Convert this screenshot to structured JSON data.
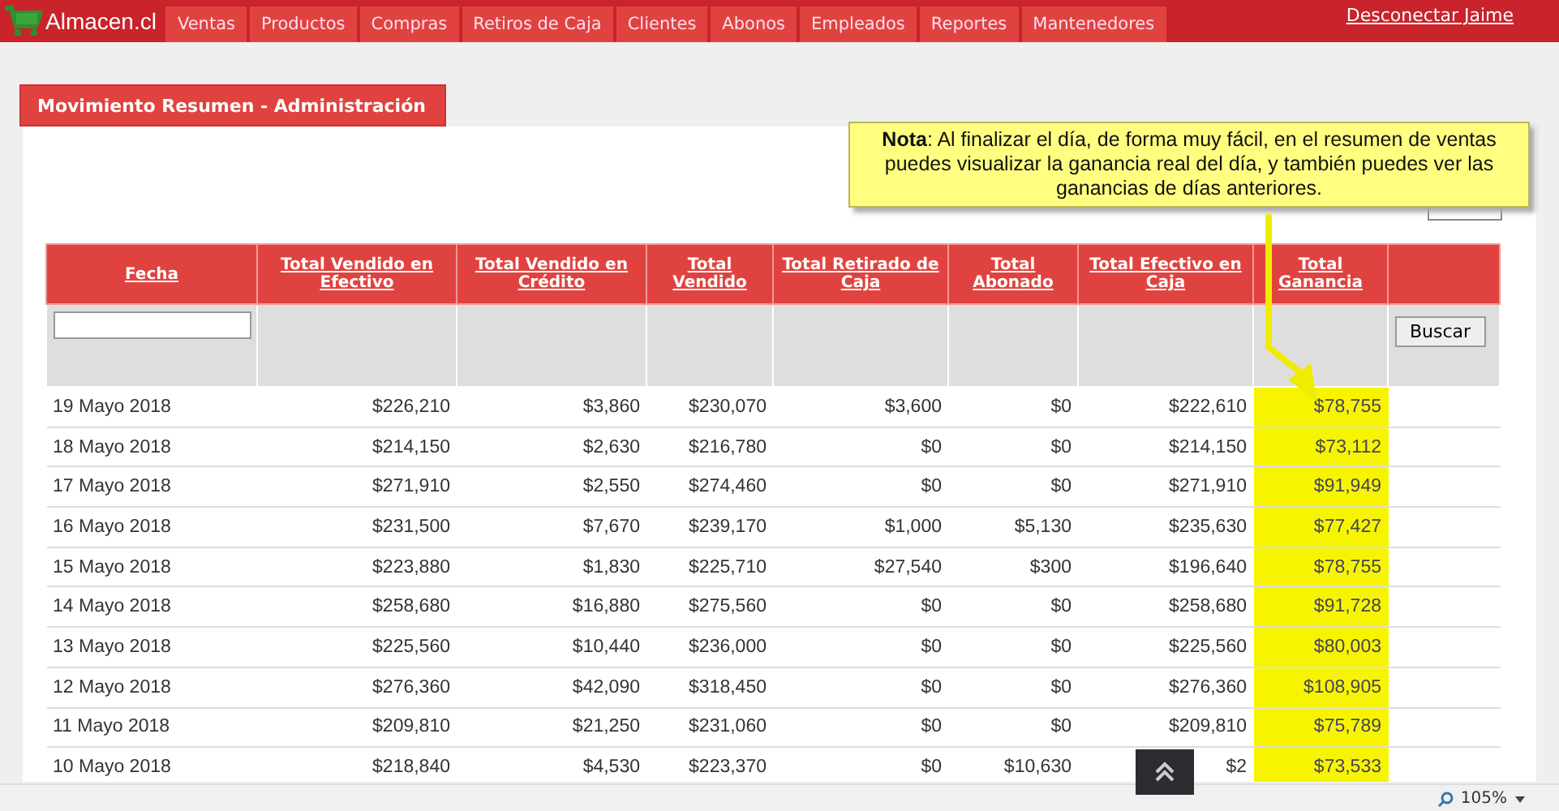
{
  "navbar": {
    "logo": "Almacen.cl",
    "items": [
      {
        "label": "Ventas",
        "selected": false
      },
      {
        "label": "Productos",
        "selected": false
      },
      {
        "label": "Compras",
        "selected": false
      },
      {
        "label": "Retiros de Caja",
        "selected": false
      },
      {
        "label": "Clientes",
        "selected": false
      },
      {
        "label": "Abonos",
        "selected": false
      },
      {
        "label": "Empleados",
        "selected": false
      },
      {
        "label": "Reportes",
        "selected": false
      },
      {
        "label": "Mantenedores",
        "selected": false
      }
    ],
    "logout": "Desconectar Jaime"
  },
  "panel": {
    "title": "Movimiento Resumen - Administración"
  },
  "note": {
    "text": "**Nota**: Al finalizar el día, de forma muy fácil, en el resumen de ventas puedes visualizar la ganancia real del día, y también puedes ver las ganancias de días anteriores."
  },
  "table": {
    "columns": [
      {
        "label": "Fecha",
        "highlighted": false
      },
      {
        "label": "Total Vendido en Efectivo",
        "highlighted": false
      },
      {
        "label": "Total Vendido en Crédito",
        "highlighted": false
      },
      {
        "label": "Total Vendido",
        "highlighted": false
      },
      {
        "label": "Total Retirado de Caja",
        "highlighted": false
      },
      {
        "label": "Total Abonado",
        "highlighted": false
      },
      {
        "label": "Total Efectivo en Caja",
        "highlighted": false
      },
      {
        "label": "Total Ganancia",
        "highlighted": true
      }
    ],
    "search_button": "Buscar",
    "rows": [
      [
        "19 Mayo 2018",
        "$226,210",
        "$3,860",
        "$230,070",
        "$3,600",
        "$0",
        "$222,610",
        "$78,755"
      ],
      [
        "18 Mayo 2018",
        "$214,150",
        "$2,630",
        "$216,780",
        "$0",
        "$0",
        "$214,150",
        "$73,112"
      ],
      [
        "17 Mayo 2018",
        "$271,910",
        "$2,550",
        "$274,460",
        "$0",
        "$0",
        "$271,910",
        "$91,949"
      ],
      [
        "16 Mayo 2018",
        "$231,500",
        "$7,670",
        "$239,170",
        "$1,000",
        "$5,130",
        "$235,630",
        "$77,427"
      ],
      [
        "15 Mayo 2018",
        "$223,880",
        "$1,830",
        "$225,710",
        "$27,540",
        "$300",
        "$196,640",
        "$78,755"
      ],
      [
        "14 Mayo 2018",
        "$258,680",
        "$16,880",
        "$275,560",
        "$0",
        "$0",
        "$258,680",
        "$91,728"
      ],
      [
        "13 Mayo 2018",
        "$225,560",
        "$10,440",
        "$236,000",
        "$0",
        "$0",
        "$225,560",
        "$80,003"
      ],
      [
        "12 Mayo 2018",
        "$276,360",
        "$42,090",
        "$318,450",
        "$0",
        "$0",
        "$276,360",
        "$108,905"
      ],
      [
        "11 Mayo 2018",
        "$209,810",
        "$21,250",
        "$231,060",
        "$0",
        "$0",
        "$209,810",
        "$75,789"
      ],
      [
        "10 Mayo 2018",
        "$218,840",
        "$4,530",
        "$223,370",
        "$0",
        "$10,630",
        "$2",
        "$73,533"
      ]
    ]
  },
  "status_bar": {
    "zoom": "105%"
  }
}
